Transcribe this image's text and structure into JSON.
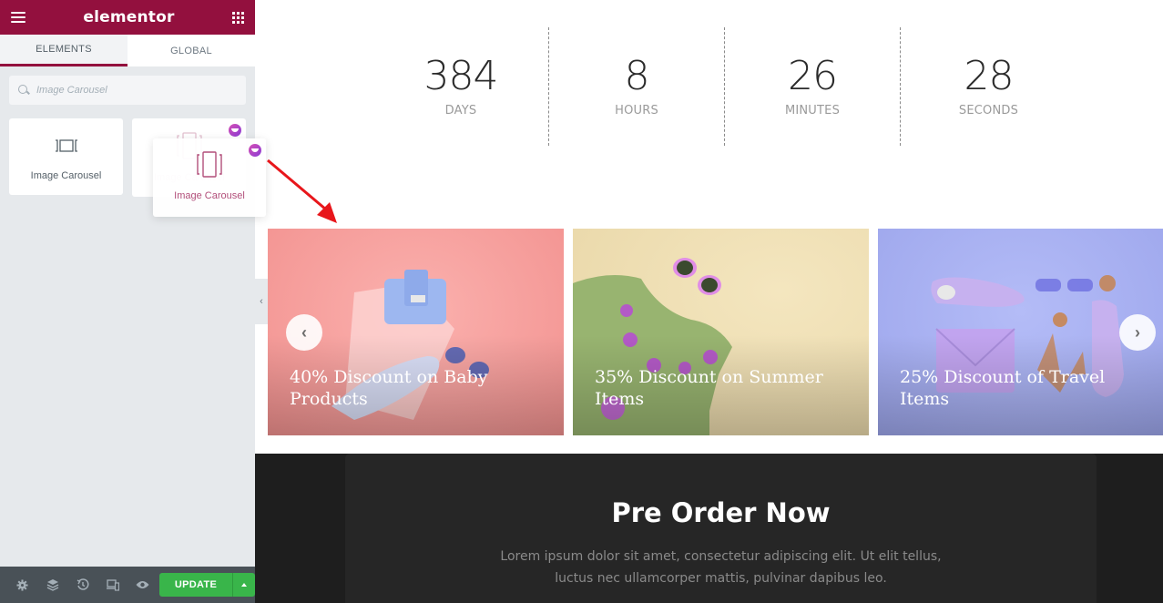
{
  "sidebar": {
    "brand": "elementor",
    "tabs": [
      {
        "label": "ELEMENTS",
        "active": true
      },
      {
        "label": "GLOBAL",
        "active": false
      }
    ],
    "search": {
      "value": "",
      "placeholder": "Image Carousel"
    },
    "widgets": [
      {
        "label": "Image Carousel",
        "icon": "image-carousel-icon",
        "pro": false
      },
      {
        "label": "Image Carousel",
        "icon": "media-carousel-icon",
        "pro": true
      }
    ],
    "dragging_widget": {
      "label": "Image Carousel",
      "icon": "media-carousel-icon",
      "pro": true
    },
    "footer": {
      "icons": [
        "settings-icon",
        "navigator-icon",
        "history-icon",
        "responsive-icon",
        "preview-icon"
      ],
      "update_label": "UPDATE"
    }
  },
  "colors": {
    "brand": "#93103e",
    "update_green": "#39b54a",
    "footer_bg": "#495157"
  },
  "countdown": [
    {
      "value": "384",
      "label": "DAYS"
    },
    {
      "value": "8",
      "label": "HOURS"
    },
    {
      "value": "26",
      "label": "MINUTES"
    },
    {
      "value": "28",
      "label": "SECONDS"
    }
  ],
  "carousel": {
    "slides": [
      {
        "caption": "40% Discount on Baby Products"
      },
      {
        "caption": "35% Discount on Summer Items"
      },
      {
        "caption": "25% Discount of Travel Items"
      }
    ],
    "prev_icon": "‹",
    "next_icon": "›"
  },
  "preorder": {
    "title": "Pre Order Now",
    "text": "Lorem ipsum dolor sit amet, consectetur adipiscing elit. Ut elit tellus, luctus nec ullamcorper mattis, pulvinar dapibus leo."
  }
}
